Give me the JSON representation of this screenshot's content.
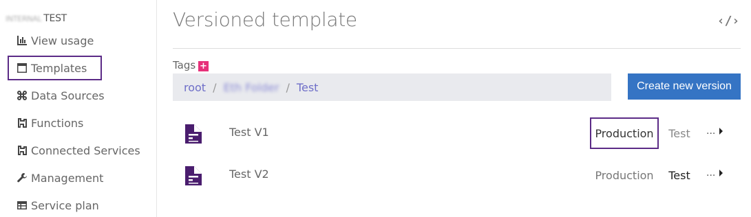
{
  "sidebar": {
    "org_blurred": "INTERNAL",
    "org_name": "TEST",
    "items": [
      {
        "label": "View usage",
        "icon": "bar-chart-icon"
      },
      {
        "label": "Templates",
        "icon": "window-icon"
      },
      {
        "label": "Data Sources",
        "icon": "command-icon"
      },
      {
        "label": "Functions",
        "icon": "plug-icon"
      },
      {
        "label": "Connected Services",
        "icon": "plug-icon"
      },
      {
        "label": "Management",
        "icon": "wrench-icon"
      },
      {
        "label": "Service plan",
        "icon": "table-icon"
      }
    ],
    "active_item": "Templates"
  },
  "header": {
    "title": "Versioned template",
    "code_toggle": "‹/›"
  },
  "tags": {
    "label": "Tags",
    "add": "+"
  },
  "breadcrumb": {
    "items": [
      "root",
      "Eth Folder",
      "Test"
    ],
    "separator": "/"
  },
  "actions": {
    "create_label": "Create new version"
  },
  "versions": [
    {
      "name": "Test V1",
      "production_label": "Production",
      "test_label": "Test",
      "more_label": "...",
      "active_env": "Production"
    },
    {
      "name": "Test V2",
      "production_label": "Production",
      "test_label": "Test",
      "more_label": "...",
      "active_env": "Test"
    }
  ],
  "colors": {
    "accent_purple": "#5b2a86",
    "doc_icon": "#4a1d6e",
    "button_blue": "#3574c4",
    "tag_add": "#e6317a",
    "link": "#6e6ec8",
    "breadcrumb_bg": "#e9eaee"
  }
}
